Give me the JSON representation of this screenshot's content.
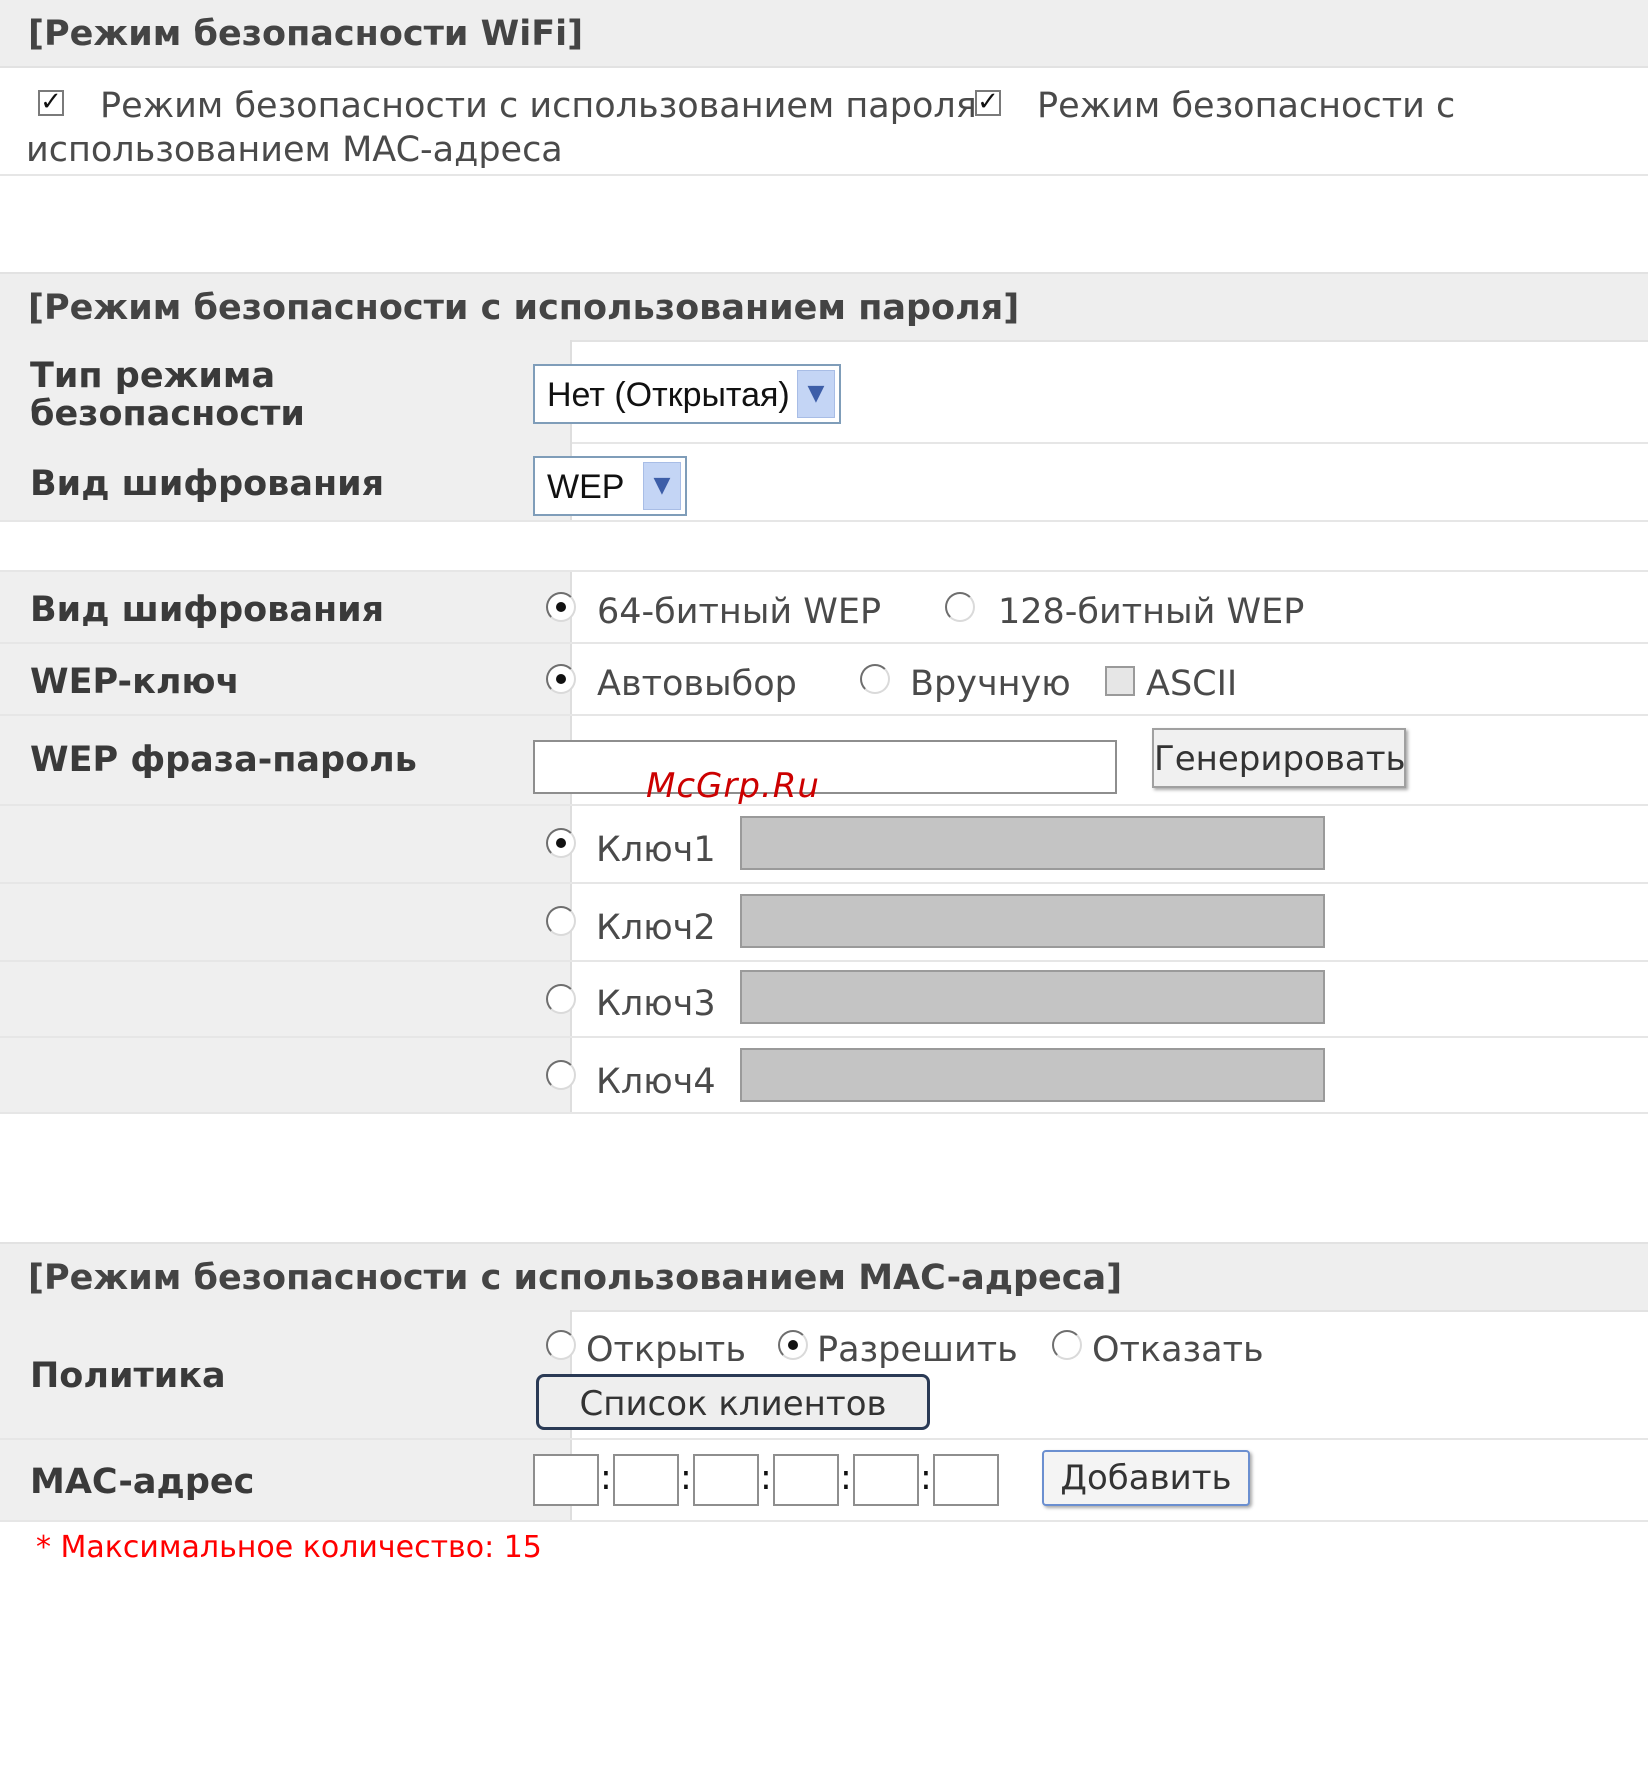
{
  "wifi_section": {
    "title": "[Режим безопасности WiFi]",
    "password_mode_label": "Режим безопасности с использованием пароля",
    "mac_mode_label_1": "Режим безопасности с",
    "mac_mode_label_2": "использованием MAC-адреса"
  },
  "password_section": {
    "title": "[Режим безопасности с использованием пароля]",
    "security_type_label_1": "Тип режима",
    "security_type_label_2": "безопасности",
    "security_type_value": "Нет (Открытая)",
    "encryption_label": "Вид шифрования",
    "encryption_value": "WEP",
    "wep_encryption_label": "Вид шифрования",
    "wep_64": "64-битный WEP",
    "wep_128": "128-битный WEP",
    "wep_key_label": "WEP-ключ",
    "auto_label": "Автовыбор",
    "manual_label": "Вручную",
    "ascii_label": "ASCII",
    "passphrase_label": "WEP фраза-пароль",
    "passphrase_value": "",
    "generate_button": "Генерировать",
    "watermark": "McGrp.Ru",
    "keys": [
      {
        "label": "Ключ1",
        "selected": true
      },
      {
        "label": "Ключ2",
        "selected": false
      },
      {
        "label": "Ключ3",
        "selected": false
      },
      {
        "label": "Ключ4",
        "selected": false
      }
    ]
  },
  "mac_section": {
    "title": "[Режим безопасности с использованием MAC-адреса]",
    "policy_label": "Политика",
    "open_label": "Открыть",
    "allow_label": "Разрешить",
    "deny_label": "Отказать",
    "client_list_button": "Список клиентов",
    "mac_label": "MAC-адрес",
    "add_button": "Добавить",
    "max_note": "* Максимальное количество: 15"
  },
  "colors": {
    "header_bg": "#eeeeee",
    "label_bg": "#efefef",
    "note_red": "#ff0000",
    "watermark_red": "#cc0000"
  }
}
